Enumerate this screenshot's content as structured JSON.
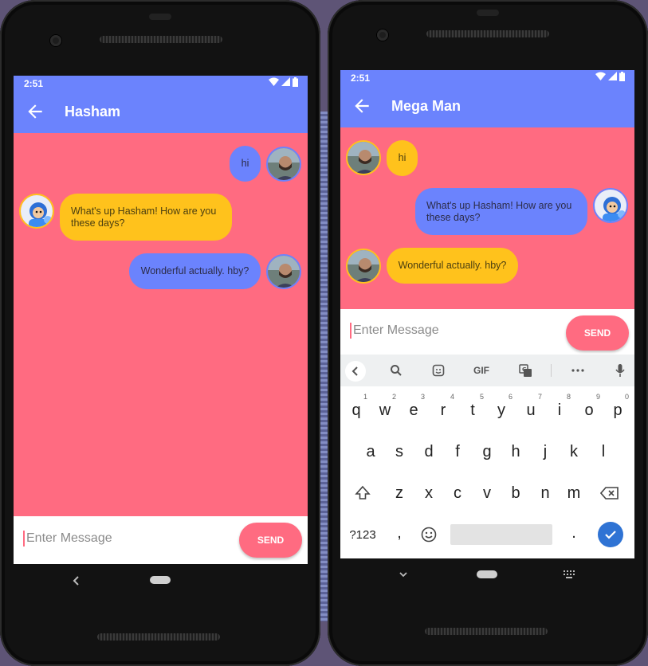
{
  "left_phone": {
    "status_time": "2:51",
    "title": "Hasham",
    "messages": [
      {
        "text": "hi",
        "side": "right"
      },
      {
        "text": "What's up Hasham! How are you these days?",
        "side": "left"
      },
      {
        "text": "Wonderful actually. hby?",
        "side": "right"
      }
    ],
    "input_placeholder": "Enter Message",
    "send_label": "SEND"
  },
  "right_phone": {
    "status_time": "2:51",
    "title": "Mega Man",
    "messages": [
      {
        "text": "hi",
        "side": "left"
      },
      {
        "text": "What's up Hasham! How are you these days?",
        "side": "right"
      },
      {
        "text": "Wonderful actually. hby?",
        "side": "left"
      }
    ],
    "input_placeholder": "Enter Message",
    "send_label": "SEND",
    "keyboard": {
      "gif_label": "GIF",
      "row1": [
        {
          "key": "q",
          "num": "1"
        },
        {
          "key": "w",
          "num": "2"
        },
        {
          "key": "e",
          "num": "3"
        },
        {
          "key": "r",
          "num": "4"
        },
        {
          "key": "t",
          "num": "5"
        },
        {
          "key": "y",
          "num": "6"
        },
        {
          "key": "u",
          "num": "7"
        },
        {
          "key": "i",
          "num": "8"
        },
        {
          "key": "o",
          "num": "9"
        },
        {
          "key": "p",
          "num": "0"
        }
      ],
      "row2": [
        "a",
        "s",
        "d",
        "f",
        "g",
        "h",
        "j",
        "k",
        "l"
      ],
      "row3": [
        "z",
        "x",
        "c",
        "v",
        "b",
        "n",
        "m"
      ],
      "symbols_label": "?123",
      "comma": ",",
      "period": "."
    }
  },
  "colors": {
    "background": "#ff6b81",
    "appbar": "#6b83fd",
    "user_bubble": "#6b83fd",
    "bot_bubble": "#ffc21c",
    "send_button": "#ff6b81"
  }
}
